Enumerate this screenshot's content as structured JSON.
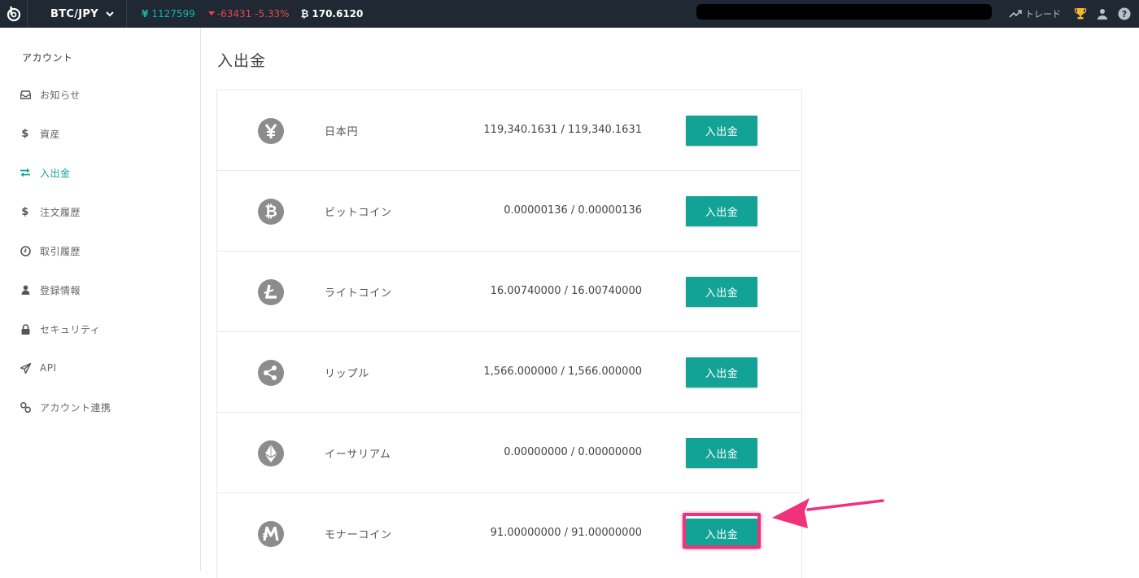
{
  "topbar": {
    "pair": "BTC/JPY",
    "price": "1127599",
    "change": "-63431 -5.33%",
    "btc_value": "170.6120",
    "trade_label": "トレード",
    "colors": {
      "bg": "#1f2833",
      "price": "#14b8a6",
      "down": "#e5484d",
      "trophy": "#f5b82e"
    }
  },
  "sidebar": {
    "title": "アカウント",
    "items": [
      {
        "label": "お知らせ",
        "icon": "inbox-icon",
        "active": false
      },
      {
        "label": "資産",
        "icon": "dollar-icon",
        "active": false
      },
      {
        "label": "入出金",
        "icon": "transfer-icon",
        "active": true
      },
      {
        "label": "注文履歴",
        "icon": "dollar-icon",
        "active": false
      },
      {
        "label": "取引履歴",
        "icon": "clock-icon",
        "active": false
      },
      {
        "label": "登録情報",
        "icon": "user-icon",
        "active": false
      },
      {
        "label": "セキュリティ",
        "icon": "lock-icon",
        "active": false
      },
      {
        "label": "API",
        "icon": "paper-plane-icon",
        "active": false
      },
      {
        "label": "アカウント連携",
        "icon": "link-icon",
        "active": false
      }
    ],
    "accent": "#12a396"
  },
  "main": {
    "title": "入出金",
    "rows": [
      {
        "name": "日本円",
        "icon": "yen-icon",
        "balance": "119,340.1631 / 119,340.1631",
        "button": "入出金"
      },
      {
        "name": "ビットコイン",
        "icon": "bitcoin-icon",
        "balance": "0.00000136 / 0.00000136",
        "button": "入出金"
      },
      {
        "name": "ライトコイン",
        "icon": "litecoin-icon",
        "balance": "16.00740000 / 16.00740000",
        "button": "入出金"
      },
      {
        "name": "リップル",
        "icon": "ripple-icon",
        "balance": "1,566.000000 / 1,566.000000",
        "button": "入出金"
      },
      {
        "name": "イーサリアム",
        "icon": "ethereum-icon",
        "balance": "0.00000000 / 0.00000000",
        "button": "入出金"
      },
      {
        "name": "モナーコイン",
        "icon": "monacoin-icon",
        "balance": "91.00000000 / 91.00000000",
        "button": "入出金"
      }
    ],
    "button_color": "#12a396",
    "highlight_color": "#f0327a"
  }
}
